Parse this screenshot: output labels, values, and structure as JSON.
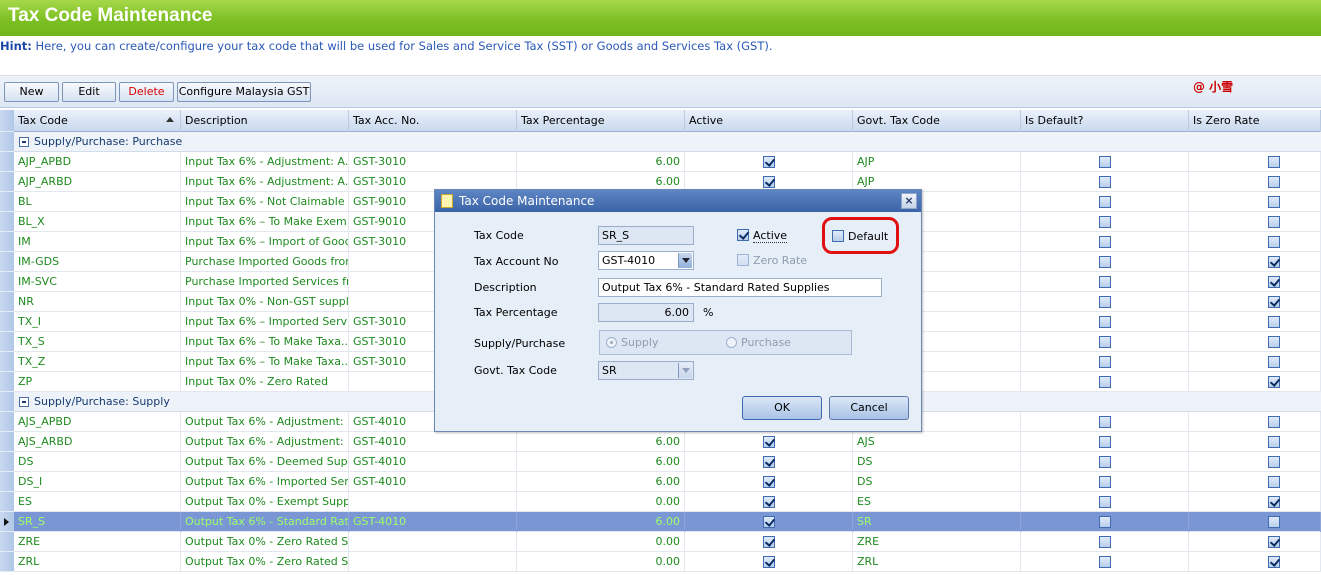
{
  "window": {
    "title": "Tax Code Maintenance"
  },
  "hint": {
    "label": "Hint:",
    "text": " Here, you can create/configure your tax code that will be used for Sales and Service Tax (SST) or Goods and Services Tax (GST)."
  },
  "toolbar": {
    "new_label": "New",
    "edit_label": "Edit",
    "delete_label": "Delete",
    "configure_label": "Configure Malaysia GST",
    "user_tag": "@ 小雪"
  },
  "grid": {
    "columns": [
      "Tax Code",
      "Description",
      "Tax Acc. No.",
      "Tax Percentage",
      "Active",
      "Govt. Tax Code",
      "Is Default?",
      "Is Zero Rate"
    ],
    "groups": [
      {
        "title": "Supply/Purchase: Purchase",
        "rows": [
          {
            "code": "AJP_APBD",
            "desc": "Input Tax 6% - Adjustment: A...",
            "acc": "GST-3010",
            "pct": "6.00",
            "active": true,
            "govt": "AJP",
            "default": false,
            "zero": false
          },
          {
            "code": "AJP_ARBD",
            "desc": "Input Tax 6% - Adjustment: A...",
            "acc": "GST-3010",
            "pct": "6.00",
            "active": true,
            "govt": "AJP",
            "default": false,
            "zero": false
          },
          {
            "code": "BL",
            "desc": "Input Tax 6% - Not Claimable",
            "acc": "GST-9010",
            "pct": "",
            "active": null,
            "govt": "",
            "default": false,
            "zero": false
          },
          {
            "code": "BL_X",
            "desc": "Input Tax 6% – To Make Exem...",
            "acc": "GST-9010",
            "pct": "",
            "active": null,
            "govt": "",
            "default": false,
            "zero": false
          },
          {
            "code": "IM",
            "desc": "Input Tax 6% – Import of Goods",
            "acc": "GST-3010",
            "pct": "",
            "active": null,
            "govt": "",
            "default": false,
            "zero": false
          },
          {
            "code": "IM-GDS",
            "desc": "Purchase Imported Goods from...",
            "acc": "",
            "pct": "",
            "active": null,
            "govt": "",
            "default": false,
            "zero": true
          },
          {
            "code": "IM-SVC",
            "desc": "Purchase Imported Services fr...",
            "acc": "",
            "pct": "",
            "active": null,
            "govt": "",
            "default": false,
            "zero": true
          },
          {
            "code": "NR",
            "desc": "Input Tax 0% - Non-GST supplier",
            "acc": "",
            "pct": "",
            "active": null,
            "govt": "",
            "default": false,
            "zero": true
          },
          {
            "code": "TX_I",
            "desc": "Input Tax 6% – Imported Servi...",
            "acc": "GST-3010",
            "pct": "",
            "active": null,
            "govt": "",
            "default": false,
            "zero": false
          },
          {
            "code": "TX_S",
            "desc": "Input Tax 6% – To Make Taxa...",
            "acc": "GST-3010",
            "pct": "",
            "active": null,
            "govt": "",
            "default": false,
            "zero": false
          },
          {
            "code": "TX_Z",
            "desc": "Input Tax 6% – To Make Taxa...",
            "acc": "GST-3010",
            "pct": "",
            "active": null,
            "govt": "",
            "default": false,
            "zero": false
          },
          {
            "code": "ZP",
            "desc": "Input Tax 0% - Zero Rated",
            "acc": "",
            "pct": "",
            "active": null,
            "govt": "",
            "default": false,
            "zero": true
          }
        ]
      },
      {
        "title": "Supply/Purchase: Supply",
        "rows": [
          {
            "code": "AJS_APBD",
            "desc": "Output Tax 6% - Adjustment: ...",
            "acc": "GST-4010",
            "pct": "",
            "active": null,
            "govt": "",
            "default": false,
            "zero": false
          },
          {
            "code": "AJS_ARBD",
            "desc": "Output Tax 6% - Adjustment: ...",
            "acc": "GST-4010",
            "pct": "6.00",
            "active": true,
            "govt": "AJS",
            "default": false,
            "zero": false
          },
          {
            "code": "DS",
            "desc": "Output Tax 6% - Deemed Sup...",
            "acc": "GST-4010",
            "pct": "6.00",
            "active": true,
            "govt": "DS",
            "default": false,
            "zero": false
          },
          {
            "code": "DS_I",
            "desc": "Output Tax 6% - Imported Ser...",
            "acc": "GST-4010",
            "pct": "6.00",
            "active": true,
            "govt": "DS",
            "default": false,
            "zero": false
          },
          {
            "code": "ES",
            "desc": "Output Tax 0% - Exempt Suppl...",
            "acc": "",
            "pct": "0.00",
            "active": true,
            "govt": "ES",
            "default": false,
            "zero": true
          },
          {
            "code": "SR_S",
            "desc": "Output Tax 6% - Standard Rat...",
            "acc": "GST-4010",
            "pct": "6.00",
            "active": true,
            "govt": "SR",
            "default": false,
            "zero": false,
            "selected": true
          },
          {
            "code": "ZRE",
            "desc": "Output Tax 0% - Zero Rated S...",
            "acc": "",
            "pct": "0.00",
            "active": true,
            "govt": "ZRE",
            "default": false,
            "zero": true
          },
          {
            "code": "ZRL",
            "desc": "Output Tax 0% - Zero Rated S...",
            "acc": "",
            "pct": "0.00",
            "active": true,
            "govt": "ZRL",
            "default": false,
            "zero": true
          }
        ]
      }
    ]
  },
  "dialog": {
    "title": "Tax Code Maintenance",
    "close_glyph": "×",
    "tax_code_label": "Tax Code",
    "tax_code_value": "SR_S",
    "active_label": "Active",
    "active_checked": true,
    "default_label": "Default",
    "default_checked": false,
    "tax_account_label": "Tax Account No",
    "tax_account_value": "GST-4010",
    "zero_rate_label": "Zero Rate",
    "description_label": "Description",
    "description_value": "Output Tax 6% - Standard Rated Supplies",
    "tax_percentage_label": "Tax Percentage",
    "tax_percentage_value": "6.00",
    "percent_sign": "%",
    "supply_purchase_label": "Supply/Purchase",
    "supply_option": "Supply",
    "purchase_option": "Purchase",
    "govt_tax_code_label": "Govt. Tax Code",
    "govt_tax_code_value": "SR",
    "ok_label": "OK",
    "cancel_label": "Cancel"
  },
  "colors": {
    "title_green": "#7ec024",
    "row_text_green": "#1e8a1e",
    "selected_row": "#7b96d4",
    "highlight_ring": "#e01010"
  }
}
